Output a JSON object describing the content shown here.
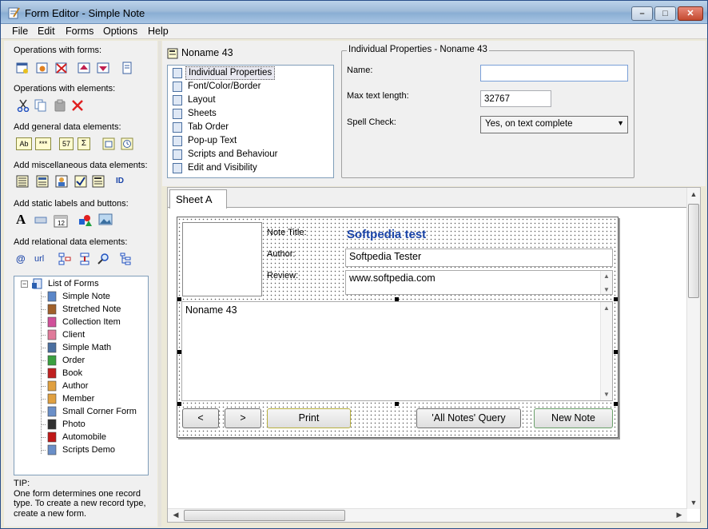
{
  "window": {
    "title": "Form Editor - Simple Note",
    "controls": {
      "minimize": "–",
      "maximize": "□",
      "close": "✕"
    }
  },
  "menu": [
    "File",
    "Edit",
    "Forms",
    "Options",
    "Help"
  ],
  "left": {
    "sections": [
      {
        "label": "Operations with forms:",
        "icons": [
          "new-form-icon",
          "form-properties-icon",
          "delete-form-icon",
          "move-up-icon",
          "move-down-icon",
          "page-icon"
        ]
      },
      {
        "label": "Operations with elements:",
        "icons": [
          "cut-icon",
          "copy-icon",
          "paste-icon",
          "delete-icon"
        ]
      },
      {
        "label": "Add general data elements:",
        "icons": [
          "text-field-icon",
          "password-field-icon",
          "number-field-icon",
          "sum-field-icon",
          "date-field-icon",
          "time-field-icon"
        ]
      },
      {
        "label": "Add miscellaneous data elements:",
        "icons": [
          "combo-icon",
          "list-icon",
          "image-icon",
          "checkbox-icon",
          "memo-icon",
          "id-icon"
        ]
      },
      {
        "label": "Add static labels and buttons:",
        "icons": [
          "label-icon",
          "line-icon",
          "calendar-icon",
          "shapes-icon",
          "picture-icon"
        ]
      },
      {
        "label": "Add relational data elements:",
        "icons": [
          "email-icon",
          "url-icon",
          "relation-icon",
          "link-icon",
          "search-icon",
          "tree-icon"
        ]
      }
    ],
    "icon_text": {
      "text": "Ab",
      "password": "***",
      "number": "57",
      "sum": "Σ",
      "id": "ID",
      "email": "@",
      "url": "url",
      "label": "A",
      "calendar": "12"
    },
    "tree": {
      "expander": "−",
      "root": "List of Forms",
      "items": [
        {
          "label": "Simple Note",
          "color": "#5a86c8"
        },
        {
          "label": "Stretched Note",
          "color": "#a0602a"
        },
        {
          "label": "Collection Item",
          "color": "#d0509a"
        },
        {
          "label": "Client",
          "color": "#e07a9a"
        },
        {
          "label": "Simple Math",
          "color": "#4a6fa0"
        },
        {
          "label": "Order",
          "color": "#3aa040"
        },
        {
          "label": "Book",
          "color": "#c02020"
        },
        {
          "label": "Author",
          "color": "#e0a040"
        },
        {
          "label": "Member",
          "color": "#e0a040"
        },
        {
          "label": "Small Corner Form",
          "color": "#6a8fc8"
        },
        {
          "label": "Photo",
          "color": "#303030"
        },
        {
          "label": "Automobile",
          "color": "#c01818"
        },
        {
          "label": "Scripts Demo",
          "color": "#6a8fc8"
        }
      ]
    },
    "tip_title": "TIP:",
    "tip_text": "One form determines one record type. To create a new record type, create a new form."
  },
  "properties": {
    "form_name": "Noname 43",
    "list": [
      "Individual Properties",
      "Font/Color/Border",
      "Layout",
      "Sheets",
      "Tab Order",
      "Pop-up Text",
      "Scripts and Behaviour",
      "Edit and Visibility"
    ],
    "selected_index": 0,
    "group_title": "Individual Properties - Noname 43",
    "name_label": "Name:",
    "name_value": "",
    "maxlen_label": "Max text length:",
    "maxlen_value": "32767",
    "spell_label": "Spell Check:",
    "spell_value": "Yes, on text complete",
    "dropdown_arrow": "▼"
  },
  "designer": {
    "tab": "Sheet A",
    "scroll_up": "▲",
    "scroll_down": "▼",
    "scroll_left": "◀",
    "scroll_right": "▶",
    "fields": {
      "title_label": "Note Title:",
      "title_value": "Softpedia test",
      "author_label": "Author:",
      "author_value": "Softpedia Tester",
      "review_label": "Review:",
      "review_value": "www.softpedia.com",
      "memo_value": "Noname 43"
    },
    "buttons": {
      "prev": "<",
      "next": ">",
      "print": "Print",
      "query": "'All Notes' Query",
      "new_note": "New Note"
    }
  }
}
